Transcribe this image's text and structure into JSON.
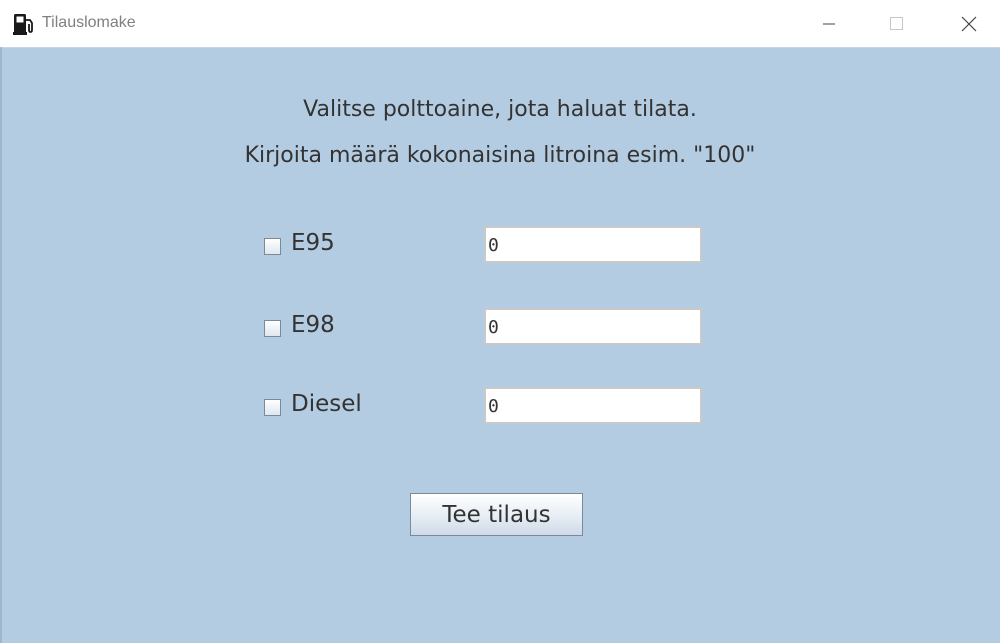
{
  "window": {
    "title": "Tilauslomake",
    "icon": "fuel-pump-icon"
  },
  "instructions": {
    "line1": "Valitse polttoaine, jota haluat tilata.",
    "line2": "Kirjoita määrä kokonaisina litroina esim. \"100\""
  },
  "fuels": [
    {
      "label": "E95",
      "checked": false,
      "amount": "0"
    },
    {
      "label": "E98",
      "checked": false,
      "amount": "0"
    },
    {
      "label": "Diesel",
      "checked": false,
      "amount": "0"
    }
  ],
  "order_button": {
    "label": "Tee tilaus"
  },
  "colors": {
    "background": "#b4cce2",
    "text": "#333333"
  }
}
